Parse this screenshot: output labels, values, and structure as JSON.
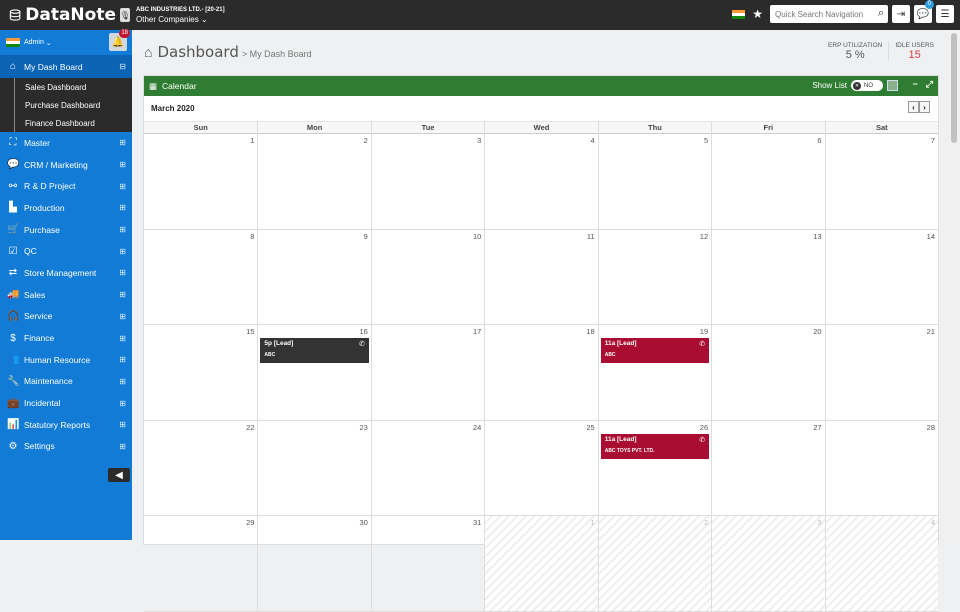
{
  "app": {
    "name": "DataNote"
  },
  "topbar": {
    "company_line1": "ABC INDUSTRIES LTD.- [20-21]",
    "company_line2": "Other Companies",
    "search_placeholder": "Quick Search Navigation",
    "chat_badge": "0"
  },
  "sidebar": {
    "user": "Admin",
    "notification_count": "18",
    "active_item": "My Dash Board",
    "sub_items": [
      "Sales Dashboard",
      "Purchase Dashboard",
      "Finance Dashboard"
    ],
    "items": [
      {
        "label": "Master",
        "icon": "cubes-icon"
      },
      {
        "label": "CRM / Marketing",
        "icon": "chat-icon"
      },
      {
        "label": "R & D Project",
        "icon": "project-icon"
      },
      {
        "label": "Production",
        "icon": "factory-icon"
      },
      {
        "label": "Purchase",
        "icon": "cart-icon"
      },
      {
        "label": "QC",
        "icon": "check-icon"
      },
      {
        "label": "Store Management",
        "icon": "transfer-icon"
      },
      {
        "label": "Sales",
        "icon": "truck-icon"
      },
      {
        "label": "Service",
        "icon": "headset-icon"
      },
      {
        "label": "Finance",
        "icon": "dollar-icon"
      },
      {
        "label": "Human Resource",
        "icon": "users-icon"
      },
      {
        "label": "Maintenance",
        "icon": "wrench-icon"
      },
      {
        "label": "Incidental",
        "icon": "briefcase-icon"
      },
      {
        "label": "Statutory Reports",
        "icon": "chart-icon"
      },
      {
        "label": "Settings",
        "icon": "gears-icon"
      }
    ]
  },
  "header": {
    "title": "Dashboard",
    "breadcrumb": "> My Dash Board",
    "erp_label": "ERP UTILIZATION",
    "erp_value": "5 %",
    "idle_label": "IDLE USERS",
    "idle_value": "15"
  },
  "calendar": {
    "title": "Calendar",
    "show_list_label": "Show List",
    "toggle_label": "NO",
    "month": "March 2020",
    "weekdays": [
      "Sun",
      "Mon",
      "Tue",
      "Wed",
      "Thu",
      "Fri",
      "Sat"
    ],
    "weeks": [
      [
        "1",
        "2",
        "3",
        "4",
        "5",
        "6",
        "7"
      ],
      [
        "8",
        "9",
        "10",
        "11",
        "12",
        "13",
        "14"
      ],
      [
        "15",
        "16",
        "17",
        "18",
        "19",
        "20",
        "21"
      ],
      [
        "22",
        "23",
        "24",
        "25",
        "26",
        "27",
        "28"
      ],
      [
        "29",
        "30",
        "31",
        "1",
        "2",
        "3",
        "4"
      ]
    ],
    "events": [
      {
        "week": 2,
        "day": 1,
        "title": "5p [Lead]",
        "detail": "ABC",
        "color": "#333333"
      },
      {
        "week": 2,
        "day": 4,
        "title": "11a [Lead]",
        "detail": "ABC",
        "color": "#a90d31"
      },
      {
        "week": 3,
        "day": 4,
        "title": "11a [Lead]",
        "detail": "ABC TOYS PVT. LTD.",
        "color": "#a90d31"
      }
    ]
  },
  "colors": {
    "sidebar": "#127bd5",
    "topbar": "#2b2b2b",
    "calendar_header": "#2f7d32"
  }
}
